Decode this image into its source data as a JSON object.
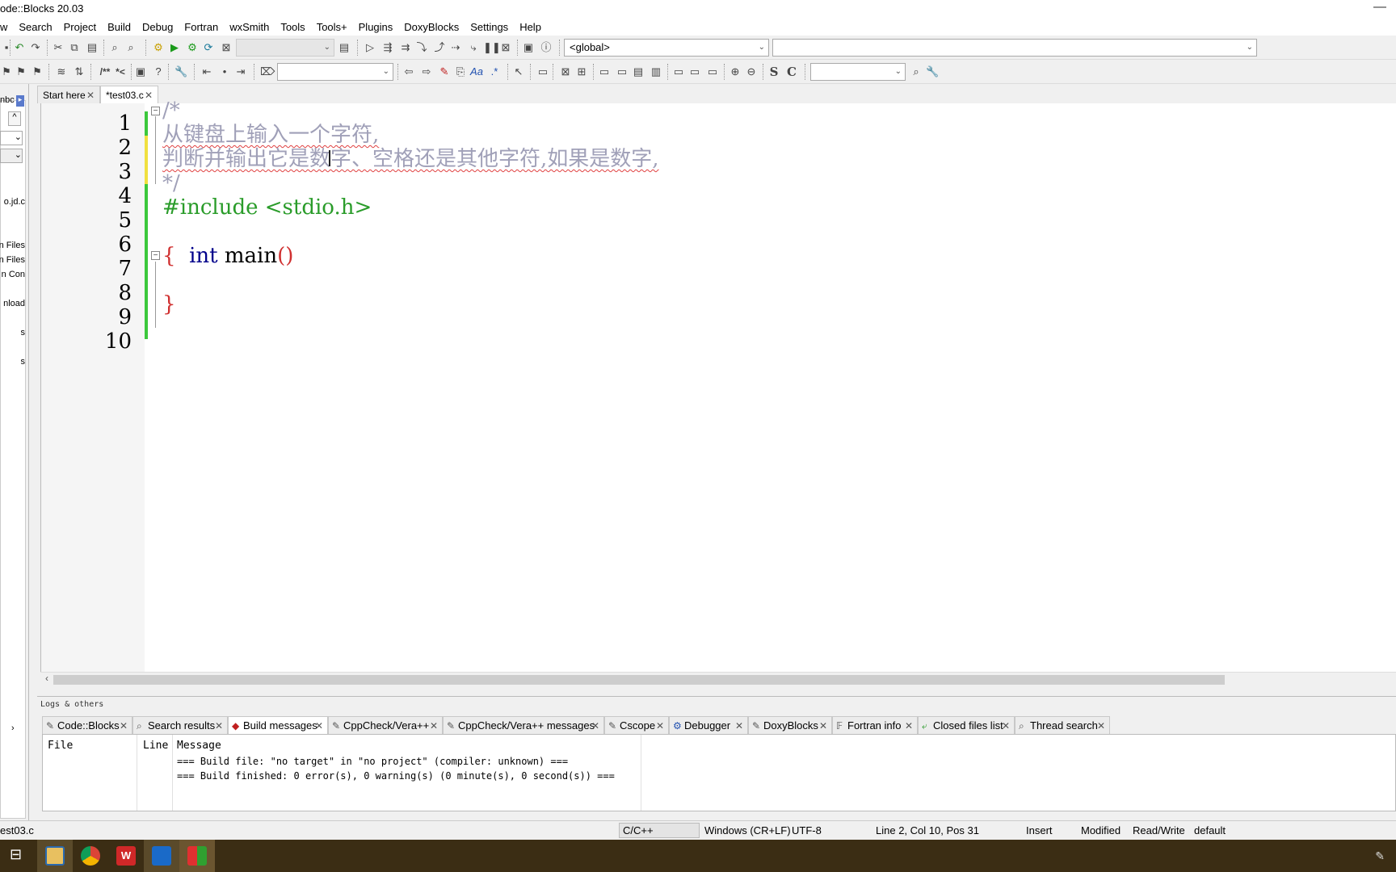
{
  "window": {
    "title": "ode::Blocks 20.03",
    "minimize_glyph": "—"
  },
  "menu": [
    "w",
    "Search",
    "Project",
    "Build",
    "Debug",
    "Fortran",
    "wxSmith",
    "Tools",
    "Tools+",
    "Plugins",
    "DoxyBlocks",
    "Settings",
    "Help"
  ],
  "toolbar": {
    "scope_combo": "<global>",
    "function_combo": "",
    "build_target_combo": "",
    "search_combo": "",
    "doxy_combo": "",
    "bold_s": "S",
    "bold_c": "C",
    "comment_1": "/**",
    "comment_2": "*<"
  },
  "left_panel": {
    "top_text": "nbc",
    "items": [
      "o.jd.c",
      "n Files",
      "n Files",
      "n Con",
      "nload",
      "s",
      "s"
    ]
  },
  "editor": {
    "tabs": [
      {
        "label": "Start here",
        "active": false
      },
      {
        "label": "*test03.c",
        "active": true
      }
    ],
    "line_numbers": [
      "1",
      "2",
      "3",
      "4",
      "5",
      "6",
      "7",
      "8",
      "9",
      "10"
    ],
    "lines": {
      "l1": "/*",
      "l2": "从键盘上输入一个字符,",
      "l3": "判断并输出它是数字、空格还是其他字符,如果是数字,",
      "l4": "*/",
      "l5": "#include <stdio.h>",
      "l6_kw": "int",
      "l6_rest": " main",
      "l6_parens": "()",
      "l7": "{",
      "l9": "}"
    },
    "colors": {
      "comment": "#a0a0b8",
      "preprocessor": "#2a9c2a",
      "keyword": "#00008b",
      "brace": "#d03030",
      "changed_saved": "#3cc83c",
      "changed_unsaved": "#f0e040"
    }
  },
  "logs": {
    "caption": "Logs & others",
    "tabs": [
      {
        "label": "Code::Blocks",
        "icon": "doc-icon"
      },
      {
        "label": "Search results",
        "icon": "search-icon"
      },
      {
        "label": "Build messages",
        "icon": "build-icon",
        "active": true
      },
      {
        "label": "CppCheck/Vera++",
        "icon": "doc-icon"
      },
      {
        "label": "CppCheck/Vera++ messages",
        "icon": "doc-icon"
      },
      {
        "label": "Cscope",
        "icon": "doc-icon"
      },
      {
        "label": "Debugger",
        "icon": "gear-icon"
      },
      {
        "label": "DoxyBlocks",
        "icon": "doc-icon"
      },
      {
        "label": "Fortran info",
        "icon": "fortran-icon"
      },
      {
        "label": "Closed files list",
        "icon": "closed-files-icon"
      },
      {
        "label": "Thread search",
        "icon": "thread-search-icon"
      }
    ],
    "columns": [
      "File",
      "Line",
      "Message"
    ],
    "messages": [
      "=== Build file: \"no target\" in \"no project\" (compiler: unknown) ===",
      "=== Build finished: 0 error(s), 0 warning(s) (0 minute(s), 0 second(s)) ==="
    ]
  },
  "statusbar": {
    "file": "est03.c",
    "language": "C/C++",
    "eol": "Windows (CR+LF)",
    "encoding": "UTF-8",
    "position": "Line 2, Col 10, Pos 31",
    "mode": "Insert",
    "modified": "Modified",
    "access": "Read/Write",
    "profile": "default"
  }
}
